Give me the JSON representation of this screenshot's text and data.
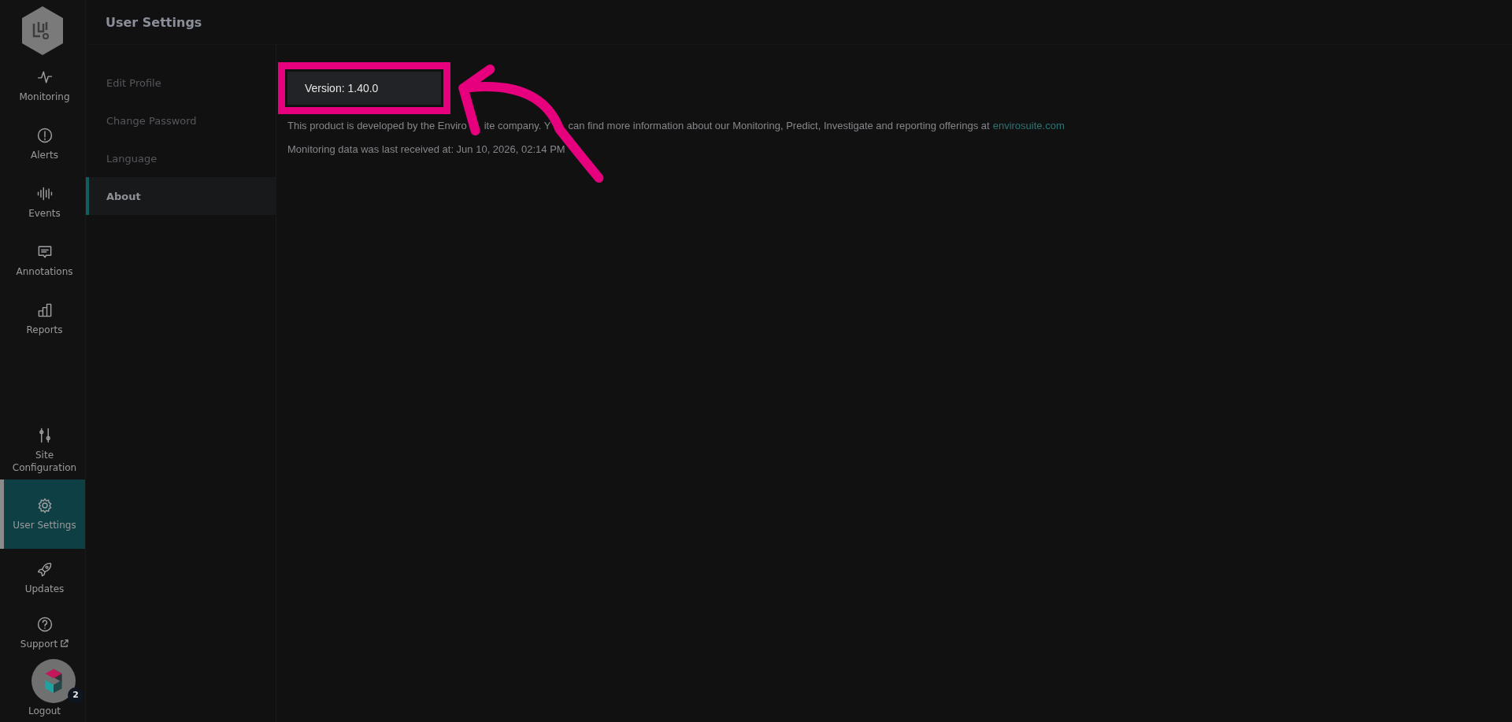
{
  "header": {
    "title": "User Settings"
  },
  "nav": {
    "items": [
      {
        "label": "Monitoring",
        "selected": false,
        "external": false
      },
      {
        "label": "Alerts",
        "selected": false,
        "external": false
      },
      {
        "label": "Events",
        "selected": false,
        "external": false
      },
      {
        "label": "Annotations",
        "selected": false,
        "external": false
      },
      {
        "label": "Reports",
        "selected": false,
        "external": false
      }
    ],
    "bottom_items": [
      {
        "label": "Site Configuration",
        "selected": false,
        "external": false
      },
      {
        "label": "User Settings",
        "selected": true,
        "external": false
      },
      {
        "label": "Updates",
        "selected": false,
        "external": false
      },
      {
        "label": "Support",
        "selected": false,
        "external": true
      },
      {
        "label": "Logout",
        "selected": false,
        "external": false
      }
    ]
  },
  "submenu": {
    "items": [
      {
        "label": "Edit Profile",
        "selected": false
      },
      {
        "label": "Change Password",
        "selected": false
      },
      {
        "label": "Language",
        "selected": false
      },
      {
        "label": "About",
        "selected": true
      }
    ]
  },
  "about": {
    "version": "Version: 1.40.0",
    "description": [
      "This product is developed by the Enviro",
      "ite company. Y",
      "can find more information about our Monitoring, Predict, Investigate and reporting offerings at"
    ],
    "link": "envirosuite.com",
    "last_received": "Monitoring data was last received at: Jun 10, 2026, 02:14 PM"
  },
  "callout": {
    "kind": "arrow"
  },
  "help_widget": {
    "badge": "2"
  }
}
